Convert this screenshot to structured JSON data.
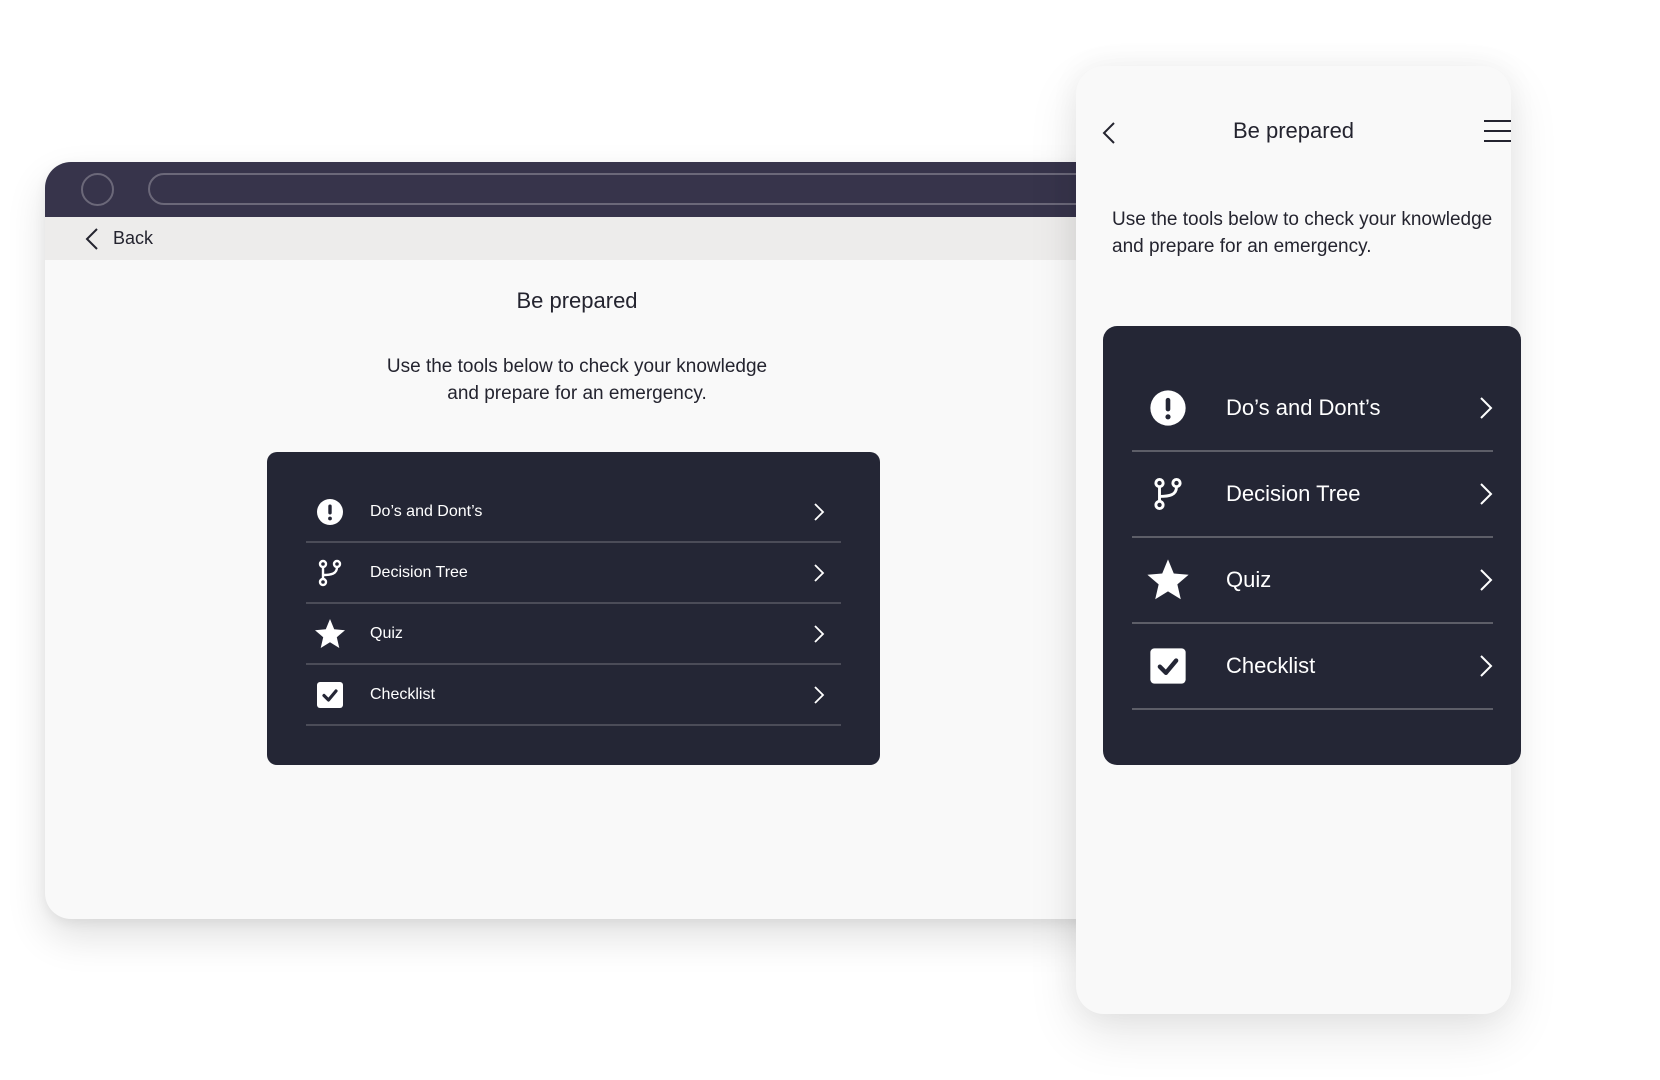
{
  "desktop": {
    "nav": {
      "back_label": "Back"
    },
    "title": "Be prepared",
    "description_lines": [
      "Use the tools below to check your knowledge",
      "and prepare for an emergency."
    ],
    "tools": [
      {
        "label": "Do’s and Dont’s",
        "icon": "alert-circle-icon"
      },
      {
        "label": "Decision Tree",
        "icon": "branch-icon"
      },
      {
        "label": "Quiz",
        "icon": "star-icon"
      },
      {
        "label": "Checklist",
        "icon": "checkbox-icon"
      }
    ]
  },
  "mobile": {
    "title": "Be prepared",
    "description_lines": [
      "Use the tools below to check your knowledge",
      "and prepare for an emergency."
    ],
    "tools": [
      {
        "label": "Do’s and Dont’s",
        "icon": "alert-circle-icon"
      },
      {
        "label": "Decision Tree",
        "icon": "branch-icon"
      },
      {
        "label": "Quiz",
        "icon": "star-icon"
      },
      {
        "label": "Checklist",
        "icon": "checkbox-icon"
      }
    ]
  },
  "colors": {
    "titlebar": "#37344b",
    "card": "#242635",
    "page_bg": "#f9f9f9",
    "text": "#24242f"
  }
}
